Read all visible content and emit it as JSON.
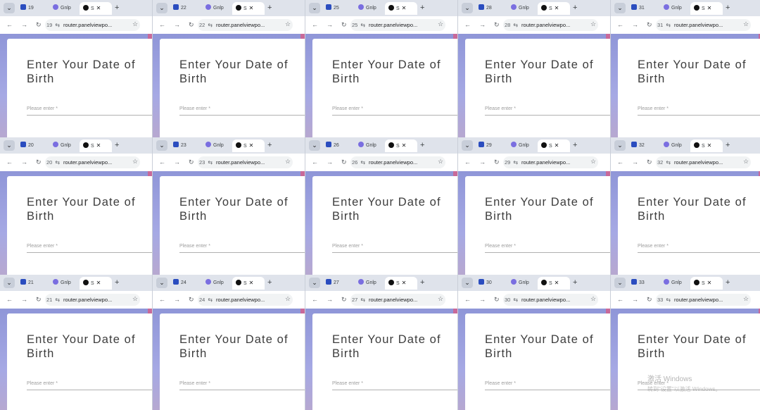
{
  "windows": [
    {
      "tab_num": "19",
      "reload_num": "19"
    },
    {
      "tab_num": "22",
      "reload_num": "22"
    },
    {
      "tab_num": "25",
      "reload_num": "25"
    },
    {
      "tab_num": "28",
      "reload_num": "28"
    },
    {
      "tab_num": "31",
      "reload_num": "31"
    },
    {
      "tab_num": "20",
      "reload_num": "20"
    },
    {
      "tab_num": "23",
      "reload_num": "23"
    },
    {
      "tab_num": "26",
      "reload_num": "26"
    },
    {
      "tab_num": "29",
      "reload_num": "29"
    },
    {
      "tab_num": "32",
      "reload_num": "32"
    },
    {
      "tab_num": "21",
      "reload_num": "21"
    },
    {
      "tab_num": "24",
      "reload_num": "24"
    },
    {
      "tab_num": "27",
      "reload_num": "27"
    },
    {
      "tab_num": "30",
      "reload_num": "30"
    },
    {
      "tab_num": "33",
      "reload_num": "33"
    }
  ],
  "shared": {
    "tab2_label": "Gnlp",
    "tab3_label": "S",
    "url": "router.panelviewpo...",
    "heading": "Enter Your Date of Birth",
    "field_placeholder": "Please enter *"
  },
  "watermark": {
    "line1": "激活 Windows",
    "line2": "转到\"设置\"以激活 Windows。"
  },
  "colors": {
    "accent_gradient": "#8f96d8",
    "tab_active": "#ffffff",
    "favicon_blue": "#2b4dbf"
  }
}
